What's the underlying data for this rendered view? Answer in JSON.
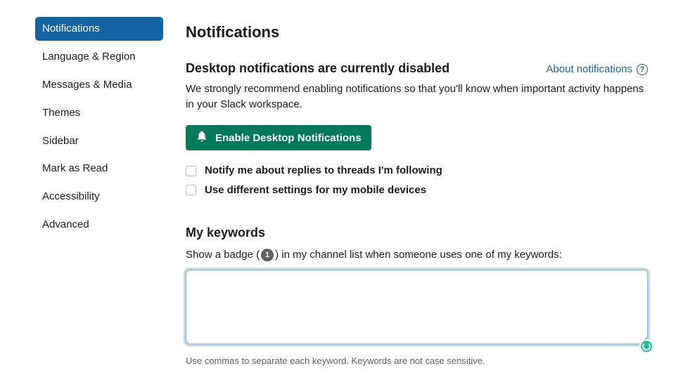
{
  "sidebar": {
    "items": [
      {
        "label": "Notifications",
        "active": true
      },
      {
        "label": "Language & Region",
        "active": false
      },
      {
        "label": "Messages & Media",
        "active": false
      },
      {
        "label": "Themes",
        "active": false
      },
      {
        "label": "Sidebar",
        "active": false
      },
      {
        "label": "Mark as Read",
        "active": false
      },
      {
        "label": "Accessibility",
        "active": false
      },
      {
        "label": "Advanced",
        "active": false
      }
    ]
  },
  "page": {
    "title": "Notifications"
  },
  "desktop_section": {
    "heading": "Desktop notifications are currently disabled",
    "about_link": "About notifications",
    "description": "We strongly recommend enabling notifications so that you'll know when important activity happens in your Slack workspace.",
    "enable_button": "Enable Desktop Notifications"
  },
  "checkboxes": {
    "notify_threads": "Notify me about replies to threads I'm following",
    "mobile_settings": "Use different settings for my mobile devices"
  },
  "keywords_section": {
    "title": "My keywords",
    "desc_prefix": "Show a badge (",
    "badge_value": "1",
    "desc_suffix": ") in my channel list when someone uses one of my keywords:",
    "textarea_value": "",
    "hint": "Use commas to separate each keyword. Keywords are not case sensitive."
  },
  "colors": {
    "primary_blue": "#1264a3",
    "primary_green": "#007a5a"
  }
}
